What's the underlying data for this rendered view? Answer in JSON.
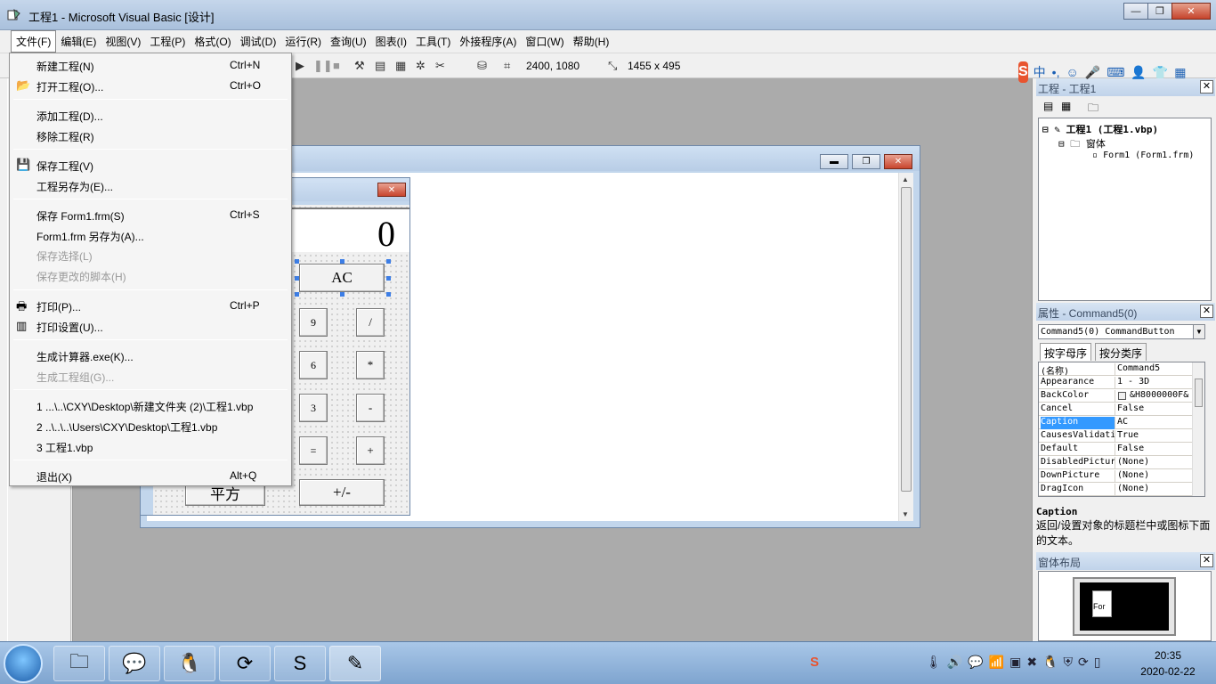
{
  "window": {
    "title": "工程1 - Microsoft Visual Basic [设计]"
  },
  "menubar": {
    "items": [
      "文件(F)",
      "编辑(E)",
      "视图(V)",
      "工程(P)",
      "格式(O)",
      "调试(D)",
      "运行(R)",
      "查询(U)",
      "图表(I)",
      "工具(T)",
      "外接程序(A)",
      "窗口(W)",
      "帮助(H)"
    ]
  },
  "toolbar": {
    "position": "2400, 1080",
    "size": "1455 x 495"
  },
  "file_menu": [
    {
      "label": "新建工程(N)",
      "shortcut": "Ctrl+N",
      "disabled": false
    },
    {
      "label": "打开工程(O)...",
      "shortcut": "Ctrl+O",
      "disabled": false
    },
    {
      "label": "添加工程(D)...",
      "shortcut": "",
      "disabled": false
    },
    {
      "label": "移除工程(R)",
      "shortcut": "",
      "disabled": false
    },
    {
      "label": "保存工程(V)",
      "shortcut": "",
      "disabled": false
    },
    {
      "label": "工程另存为(E)...",
      "shortcut": "",
      "disabled": false
    },
    {
      "label": "保存 Form1.frm(S)",
      "shortcut": "Ctrl+S",
      "disabled": false
    },
    {
      "label": "Form1.frm 另存为(A)...",
      "shortcut": "",
      "disabled": false
    },
    {
      "label": "保存选择(L)",
      "shortcut": "",
      "disabled": true
    },
    {
      "label": "保存更改的脚本(H)",
      "shortcut": "",
      "disabled": true
    },
    {
      "label": "打印(P)...",
      "shortcut": "Ctrl+P",
      "disabled": false
    },
    {
      "label": "打印设置(U)...",
      "shortcut": "",
      "disabled": false
    },
    {
      "label": "生成计算器.exe(K)...",
      "shortcut": "",
      "disabled": false
    },
    {
      "label": "生成工程组(G)...",
      "shortcut": "",
      "disabled": true
    },
    {
      "label": "1 ...\\..\\CXY\\Desktop\\新建文件夹 (2)\\工程1.vbp",
      "shortcut": "",
      "disabled": false
    },
    {
      "label": "2 ..\\..\\..\\Users\\CXY\\Desktop\\工程1.vbp",
      "shortcut": "",
      "disabled": false
    },
    {
      "label": "3 工程1.vbp",
      "shortcut": "",
      "disabled": false
    },
    {
      "label": "退出(X)",
      "shortcut": "Alt+Q",
      "disabled": false
    }
  ],
  "calculator": {
    "display": "0",
    "buttons": [
      "AC",
      "9",
      "/",
      "6",
      "*",
      "3",
      "-",
      "=",
      "+",
      "平方",
      "+/-"
    ]
  },
  "project_panel": {
    "title": "工程 - 工程1",
    "tree": [
      "工程1 (工程1.vbp)",
      "窗体",
      "Form1 (Form1.frm)"
    ]
  },
  "properties_panel": {
    "title": "属性 - Command5(0)",
    "object": "Command5(0) CommandButton",
    "tabs": [
      "按字母序",
      "按分类序"
    ],
    "rows": [
      {
        "name": "(名称)",
        "value": "Command5"
      },
      {
        "name": "Appearance",
        "value": "1 - 3D"
      },
      {
        "name": "BackColor",
        "value": "&H8000000F&"
      },
      {
        "name": "Cancel",
        "value": "False"
      },
      {
        "name": "Caption",
        "value": "AC"
      },
      {
        "name": "CausesValidati",
        "value": "True"
      },
      {
        "name": "Default",
        "value": "False"
      },
      {
        "name": "DisabledPictur",
        "value": "(None)"
      },
      {
        "name": "DownPicture",
        "value": "(None)"
      },
      {
        "name": "DragIcon",
        "value": "(None)"
      }
    ],
    "selected": 4,
    "desc_title": "Caption",
    "desc_text": "返回/设置对象的标题栏中或图标下面的文本。"
  },
  "layout_panel": {
    "title": "窗体布局",
    "mini_form": "For"
  },
  "ime": {
    "lang": "中",
    "punct": "•,"
  },
  "clock": {
    "time": "20:35",
    "date": "2020-02-22"
  }
}
